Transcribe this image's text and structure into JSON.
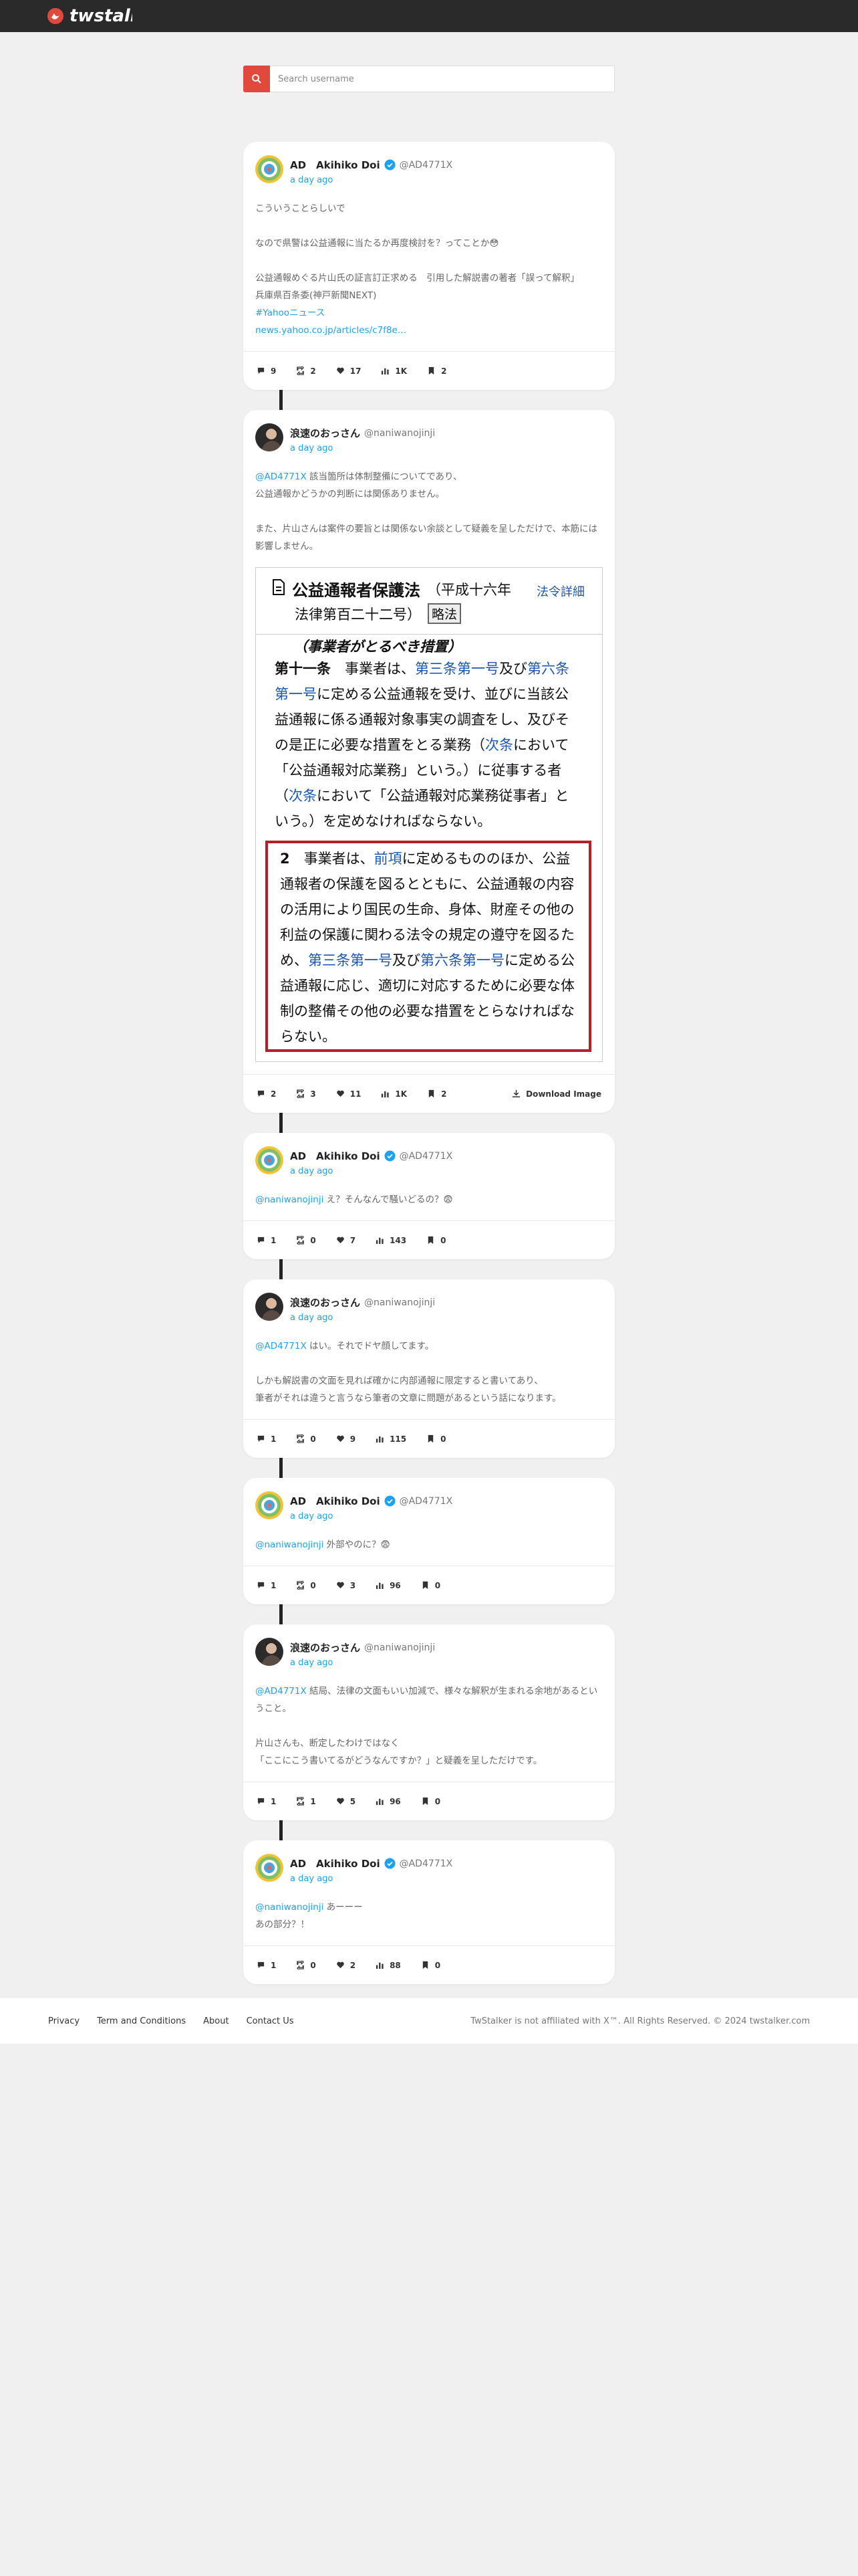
{
  "app": {
    "logo_text": "twstalker"
  },
  "search": {
    "placeholder": "Search username"
  },
  "posts": [
    {
      "name": "AD　Akihiko Doi",
      "handle": "@AD4771X",
      "time": "a day ago",
      "verified": true,
      "text_lines": [
        "こういうことらしいで",
        "",
        "なので県警は公益通報に当たるか再度検討を？ってことか😳",
        "",
        "公益通報めぐる片山氏の証言訂正求める　引用した解説書の著者「誤って解釈」",
        "兵庫県百条委(神戸新聞NEXT)"
      ],
      "hashtag": "#Yahooニュース",
      "link": "news.yahoo.co.jp/articles/c7f8e…",
      "stats": {
        "replies": "9",
        "retweets": "2",
        "likes": "17",
        "views": "1K",
        "bookmarks": "2"
      }
    },
    {
      "name": "浪速のおっさん",
      "handle": "@naniwanojinji",
      "time": "a day ago",
      "verified": false,
      "mention": "@AD4771X",
      "text_after_mention": " 該当箇所は体制整備についてであり、\n公益通報かどうかの判断には関係ありません。\n\nまた、片山さんは案件の要旨とは関係ない余談として疑義を呈しただけで、本筋には影響しません。",
      "document": {
        "title": "公益通報者保護法",
        "subtitle": "（平成十六年",
        "line2": "法律第百二十二号）",
        "badge": "略法",
        "link": "法令詳細",
        "caption": "（事業者がとるべき措置）",
        "article": "第十一条",
        "para1_segments": [
          "　事業者は、",
          "第三条第一号",
          "及び",
          "第六条第一号",
          "に定める公益通報を受け、並びに当該公益通報に係る通報対象事実の調査をし、及びその是正に必要な措置をとる業務（",
          "次条",
          "において「公益通報対応業務」という。）に従事する者（",
          "次条",
          "において「公益通報対応業務従事者」という。）を定めなければならない。"
        ],
        "para2_num": "2",
        "para2_segments": [
          "　事業者は、",
          "前項",
          "に定めるもののほか、公益通報者の保護を図るとともに、公益通報の内容の活用により国民の生命、身体、財産その他の利益の保護に関わる法令の規定の遵守を図るため、",
          "第三条第一号",
          "及び",
          "第六条第一号",
          "に定める公益通報に応じ、適切に対応するために必要な体制の整備その他の必要な措置をとらなければならない。"
        ]
      },
      "download_label": "Download Image",
      "stats": {
        "replies": "2",
        "retweets": "3",
        "likes": "11",
        "views": "1K",
        "bookmarks": "2"
      }
    },
    {
      "name": "AD　Akihiko Doi",
      "handle": "@AD4771X",
      "time": "a day ago",
      "verified": true,
      "mention": "@naniwanojinji",
      "text_after_mention": " え？そんなんで騒いどるの？😨",
      "stats": {
        "replies": "1",
        "retweets": "0",
        "likes": "7",
        "views": "143",
        "bookmarks": "0"
      }
    },
    {
      "name": "浪速のおっさん",
      "handle": "@naniwanojinji",
      "time": "a day ago",
      "verified": false,
      "mention": "@AD4771X",
      "text_after_mention": " はい。それでドヤ顔してます。\n\nしかも解説書の文面を見れば確かに内部通報に限定すると書いてあり、\n筆者がそれは違うと言うなら筆者の文章に問題があるという話になります。",
      "stats": {
        "replies": "1",
        "retweets": "0",
        "likes": "9",
        "views": "115",
        "bookmarks": "0"
      }
    },
    {
      "name": "AD　Akihiko Doi",
      "handle": "@AD4771X",
      "time": "a day ago",
      "verified": true,
      "mention": "@naniwanojinji",
      "text_after_mention": " 外部やのに？😨",
      "stats": {
        "replies": "1",
        "retweets": "0",
        "likes": "3",
        "views": "96",
        "bookmarks": "0"
      }
    },
    {
      "name": "浪速のおっさん",
      "handle": "@naniwanojinji",
      "time": "a day ago",
      "verified": false,
      "mention": "@AD4771X",
      "text_after_mention": " 結局、法律の文面もいい加減で、様々な解釈が生まれる余地があるということ。\n\n片山さんも、断定したわけではなく\n「ここにこう書いてるがどうなんですか？」と疑義を呈しただけです。",
      "stats": {
        "replies": "1",
        "retweets": "1",
        "likes": "5",
        "views": "96",
        "bookmarks": "0"
      }
    },
    {
      "name": "AD　Akihiko Doi",
      "handle": "@AD4771X",
      "time": "a day ago",
      "verified": true,
      "mention": "@naniwanojinji",
      "text_after_mention": " あーーー\nあの部分？！",
      "stats": {
        "replies": "1",
        "retweets": "0",
        "likes": "2",
        "views": "88",
        "bookmarks": "0"
      }
    }
  ],
  "footer": {
    "links": [
      "Privacy",
      "Term and Conditions",
      "About",
      "Contact Us"
    ],
    "copyright": "TwStalker is not affiliated with X™. All Rights Reserved. © 2024 twstalker.com"
  },
  "colors": {
    "accent": "#1da1f2",
    "search_button": "#e0493c",
    "topbar": "#2a2a2a",
    "highlight_box": "#b3202a"
  },
  "icons": [
    "search-icon",
    "verified-icon",
    "reply-icon",
    "retweet-icon",
    "heart-icon",
    "views-icon",
    "bookmark-icon",
    "download-icon",
    "document-icon"
  ]
}
